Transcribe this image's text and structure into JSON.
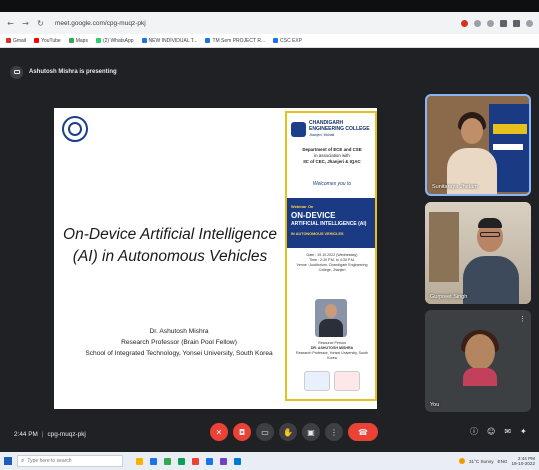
{
  "browser": {
    "url": "meet.google.com/cpg-muqz-pkj",
    "bookmarks": [
      {
        "label": "Gmail",
        "color": "#d93025"
      },
      {
        "label": "YouTube",
        "color": "#ff0000"
      },
      {
        "label": "Maps",
        "color": "#34a853"
      },
      {
        "label": "(2) WhatsApp",
        "color": "#25d366"
      },
      {
        "label": "NEW INDIVIDUAL T...",
        "color": "#1a73e8"
      },
      {
        "label": "TM Sem PROJECT R...",
        "color": "#1a73e8"
      },
      {
        "label": "CSC EXP",
        "color": "#1a73e8"
      }
    ]
  },
  "meet": {
    "presenting_label": "Ashutosh Mishra is presenting",
    "meeting_time": "2:44 PM",
    "meeting_code": "cpg-muqz-pkj",
    "participants": [
      {
        "name": "Sunitaraya Jhetam",
        "pinned": true
      },
      {
        "name": "Gurpreet Singh"
      },
      {
        "name": "You"
      }
    ]
  },
  "slide": {
    "title_line1": "On-Device Artificial Intelligence",
    "title_line2": "(AI) in Autonomous Vehicles",
    "presenter_name": "Dr. Ashutosh Mishra",
    "presenter_role": "Research Professor (Brain Pool Fellow)",
    "presenter_affiliation": "School of Integrated Technology, Yonsei University, South Korea"
  },
  "poster": {
    "college_line1": "CHANDIGARH",
    "college_line2": "ENGINEERING COLLEGE",
    "college_line3": "Jhanjeri, Mohali",
    "dept_line1": "Department of ECE and CSE",
    "dept_line2": "in association with",
    "dept_line3": "IIC of CEC, Jhanjeri & IQAC",
    "welcome": "Welcomes you to",
    "band_tag": "Webinar On",
    "band_title_line1": "ON-DEVICE",
    "band_title_line2": "ARTIFICIAL INTELLIGENCE (AI)",
    "band_sub": "IN AUTONOMOUS VEHICLES",
    "date_line1": "Date : 19.10.2022 (Wednesday)",
    "date_line2": "Time : 2:30 P.M. to 4:30 P.M.",
    "date_line3": "Venue : Auditorium, Chandigarh Engineering College, Jhanjeri",
    "speaker_line1": "Resource Person",
    "speaker_line2": "DR. ASHUTOSH MISHRA",
    "speaker_line3": "Research Professor, Yonsei University, South Korea"
  },
  "taskbar": {
    "search_placeholder": "Type here to search",
    "weather": "31°C Sunny",
    "time": "2:44 PM",
    "date": "19-10-2022",
    "lang": "ENG",
    "apps": [
      "#f4b400",
      "#1a73e8",
      "#34a853",
      "#0f9d58",
      "#ea4335",
      "#1a73e8",
      "#6f42c1",
      "#0078d4"
    ]
  }
}
